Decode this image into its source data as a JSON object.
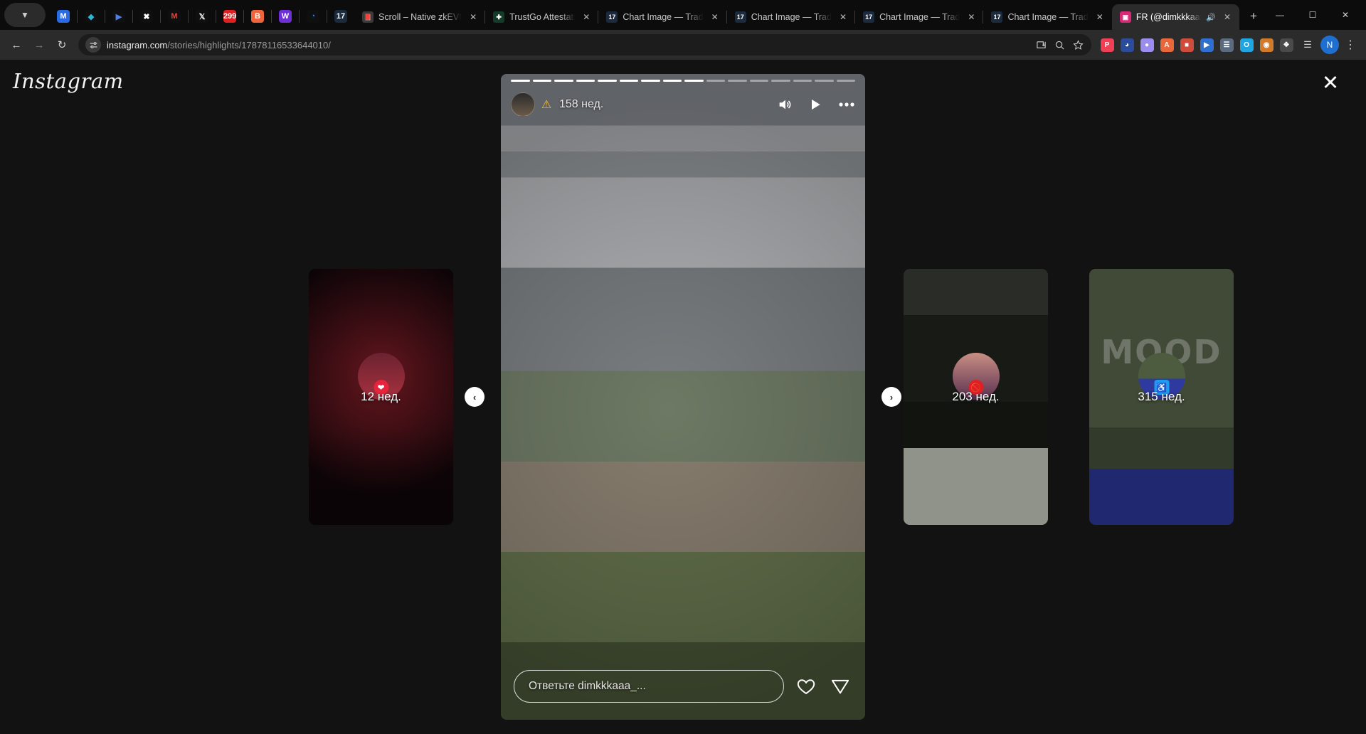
{
  "browser": {
    "pinned_icons": [
      {
        "name": "metamask-icon",
        "glyph": "M",
        "color": "#2a6be5"
      },
      {
        "name": "rabby-icon",
        "glyph": "◆",
        "color": "#0f0f0f",
        "fg": "#2fb6d6"
      },
      {
        "name": "phantom-icon",
        "glyph": "▶",
        "color": "#0f0f0f",
        "fg": "#4f7fe8"
      },
      {
        "name": "backpack-icon",
        "glyph": "✖",
        "color": "#0f0f0f",
        "fg": "#ffffff"
      },
      {
        "name": "gmail-icon",
        "glyph": "M",
        "color": "#0f0f0f",
        "fg": "#e84335"
      },
      {
        "name": "twitter-x-icon",
        "glyph": "𝕏",
        "color": "#0f0f0f",
        "fg": "#ffffff"
      },
      {
        "name": "calendar-icon",
        "glyph": "299",
        "color": "#e02020"
      },
      {
        "name": "binance-icon",
        "glyph": "B",
        "color": "#f0643c"
      },
      {
        "name": "wallet-w-icon",
        "glyph": "W",
        "color": "#6e2fd6"
      },
      {
        "name": "opera-icon",
        "glyph": "◔",
        "color": "#0f0f0f",
        "fg": "#2f7fe8"
      },
      {
        "name": "tradingview-icon",
        "glyph": "17",
        "color": "#1b2a3d"
      }
    ],
    "tabs": [
      {
        "title": "Scroll – Native zkEVM L",
        "favicon": "📕",
        "fav_color": "#3a3a3a",
        "active": false,
        "muted": false
      },
      {
        "title": "TrustGo Attestation",
        "favicon": "✚",
        "fav_color": "#143a2a",
        "active": false,
        "muted": false
      },
      {
        "title": "Chart Image — Trading",
        "favicon": "17",
        "fav_color": "#1b2a3d",
        "active": false,
        "muted": false
      },
      {
        "title": "Chart Image — Trading",
        "favicon": "17",
        "fav_color": "#1b2a3d",
        "active": false,
        "muted": false
      },
      {
        "title": "Chart Image — Trading",
        "favicon": "17",
        "fav_color": "#1b2a3d",
        "active": false,
        "muted": false
      },
      {
        "title": "Chart Image — Trading",
        "favicon": "17",
        "fav_color": "#1b2a3d",
        "active": false,
        "muted": false
      },
      {
        "title": "FR (@dimkkkaaa_)",
        "favicon": "▣",
        "fav_color": "#d62976",
        "active": true,
        "muted": true
      }
    ],
    "new_tab_label": "+",
    "window_controls": {
      "minimize": "—",
      "maximize": "☐",
      "close": "✕"
    },
    "nav": {
      "back": "←",
      "forward": "→",
      "reload": "↻"
    },
    "omnibox": {
      "site_settings_icon": "tune-icon",
      "url_host": "instagram.com",
      "url_path": "/stories/highlights/17878116533644010/",
      "install_icon": "⬇",
      "zoom_icon": "⊕",
      "bookmark_icon": "☆"
    },
    "extensions": [
      {
        "name": "pocket-extension",
        "glyph": "P",
        "color": "#ef4056"
      },
      {
        "name": "wallet-extension",
        "glyph": "◕",
        "color": "#2b4c9b"
      },
      {
        "name": "ghost-extension",
        "glyph": "●",
        "color": "#9b8cf0"
      },
      {
        "name": "arkham-extension",
        "glyph": "A",
        "color": "#e8673c"
      },
      {
        "name": "lock-extension",
        "glyph": "■",
        "color": "#cf4b3a"
      },
      {
        "name": "video-extension",
        "glyph": "▶",
        "color": "#2f6fd0"
      },
      {
        "name": "notes-extension",
        "glyph": "☰",
        "color": "#5a6b80"
      },
      {
        "name": "opera-extension",
        "glyph": "O",
        "color": "#1fa5e0"
      },
      {
        "name": "monkey-extension",
        "glyph": "◉",
        "color": "#d07a2a"
      },
      {
        "name": "puzzle-extension",
        "glyph": "❖",
        "color": "#4a4a4a"
      }
    ],
    "reading_list_icon": "☰",
    "profile_initial": "N",
    "menu_icon": "⋮"
  },
  "page": {
    "brand": "Instagram",
    "close_label": "✕",
    "prev_arrow": "‹",
    "next_arrow": "›",
    "story": {
      "progress_total": 16,
      "progress_done": 9,
      "time_label": "158 нед.",
      "warning_icon": "⚠",
      "volume_icon": "🔊",
      "play_icon": "▶",
      "more_icon": "•••",
      "reply_placeholder": "Ответьте dimkkkaaa_...",
      "like_icon": "♡",
      "share_icon": "▽"
    },
    "side_cards": [
      {
        "position": "left",
        "time_label": "12 нед.",
        "badge": "❤",
        "badge_color": "#e8243c",
        "scene": "scene-a",
        "overlay_text": ""
      },
      {
        "position": "right-1",
        "time_label": "203 нед.",
        "badge": "🚫",
        "badge_color": "#e02020",
        "scene": "scene-b",
        "overlay_text": ""
      },
      {
        "position": "right-2",
        "time_label": "315 нед.",
        "badge": "♿",
        "badge_color": "#1e9cf0",
        "scene": "scene-c",
        "overlay_text": "MOOD"
      }
    ]
  }
}
